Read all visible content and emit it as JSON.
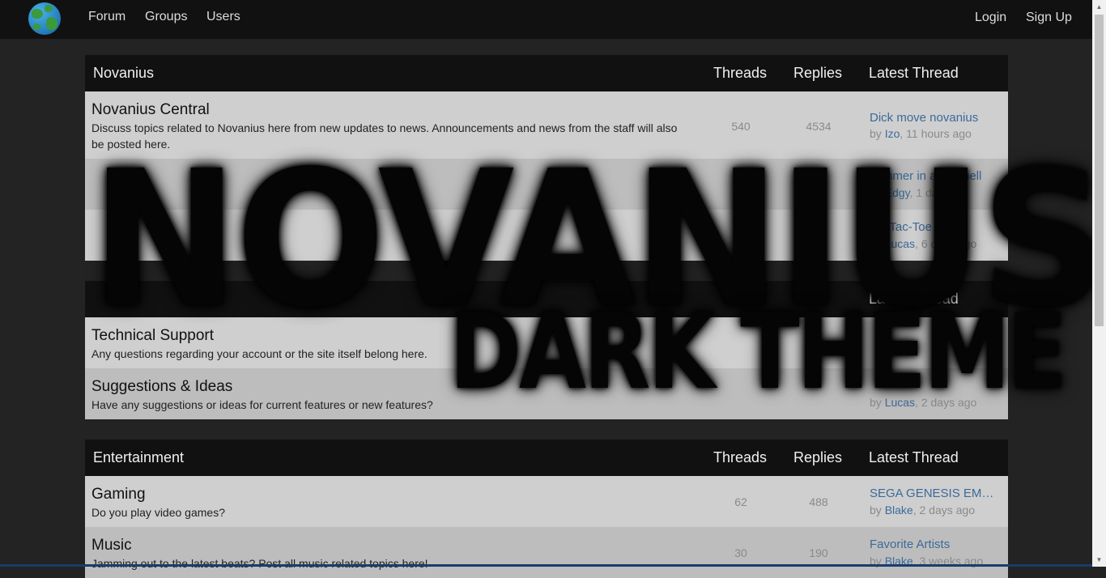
{
  "nav": {
    "logo": "globe-logo-icon",
    "items": [
      {
        "label": "Forum"
      },
      {
        "label": "Groups"
      },
      {
        "label": "Users"
      }
    ],
    "login": "Login",
    "signup": "Sign Up"
  },
  "sections": [
    {
      "title": "Novanius",
      "threads_header": "Threads",
      "replies_header": "Replies",
      "latest_header": "Latest Thread",
      "forums": [
        {
          "name": "Novanius Central",
          "description": "Discuss topics related to Novanius here from new updates to news. Announcements and news from the staff will also be posted here.",
          "threads": "540",
          "replies": "4534",
          "latest_title": "Dick move novanius",
          "latest_by": "by ",
          "latest_user": "Izo",
          "latest_time": ", 11 hours ago"
        },
        {
          "name": "",
          "description": "",
          "threads": "",
          "replies": "",
          "latest_title": "summer in a nutshell",
          "latest_by": "by ",
          "latest_user": "Edgy",
          "latest_time": ", 1 day ago"
        },
        {
          "name": "",
          "description": "",
          "threads": "",
          "replies": "",
          "latest_title": "Tic-Tac-Toe (ish)",
          "latest_by": "by ",
          "latest_user": "Lucas",
          "latest_time": ", 6 days ago"
        }
      ]
    },
    {
      "title": "",
      "threads_header": "",
      "replies_header": "",
      "latest_header": "Latest Thread",
      "forums": [
        {
          "name": "Technical Support",
          "description": "Any questions regarding your account or the site itself belong here.",
          "threads": "",
          "replies": "",
          "latest_title": "",
          "latest_by": "",
          "latest_user": "",
          "latest_time": ""
        },
        {
          "name": "Suggestions & Ideas",
          "description": "Have any suggestions or ideas for current features or new features?",
          "threads": "",
          "replies": "",
          "latest_title": "",
          "latest_by": "by ",
          "latest_user": "Lucas",
          "latest_time": ", 2 days ago"
        }
      ]
    },
    {
      "title": "Entertainment",
      "threads_header": "Threads",
      "replies_header": "Replies",
      "latest_header": "Latest Thread",
      "forums": [
        {
          "name": "Gaming",
          "description": "Do you play video games?",
          "threads": "62",
          "replies": "488",
          "latest_title": "SEGA GENESIS EMULATOR",
          "latest_by": "by ",
          "latest_user": "Blake",
          "latest_time": ", 2 days ago"
        },
        {
          "name": "Music",
          "description": "Jamming out to the latest beats? Post all music related topics here!",
          "threads": "30",
          "replies": "190",
          "latest_title": "Favorite Artists",
          "latest_by": "by ",
          "latest_user": "Blake",
          "latest_time": ", 3 weeks ago"
        }
      ]
    }
  ],
  "overlay": {
    "line1": "NOVANIUS",
    "line2": "DARK THEME"
  },
  "colors": {
    "page_bg": "#232323",
    "header_bg": "#111111",
    "row_light": "#cfcfcf",
    "row_dark": "#bdbdbd",
    "link": "#3c6a99"
  }
}
